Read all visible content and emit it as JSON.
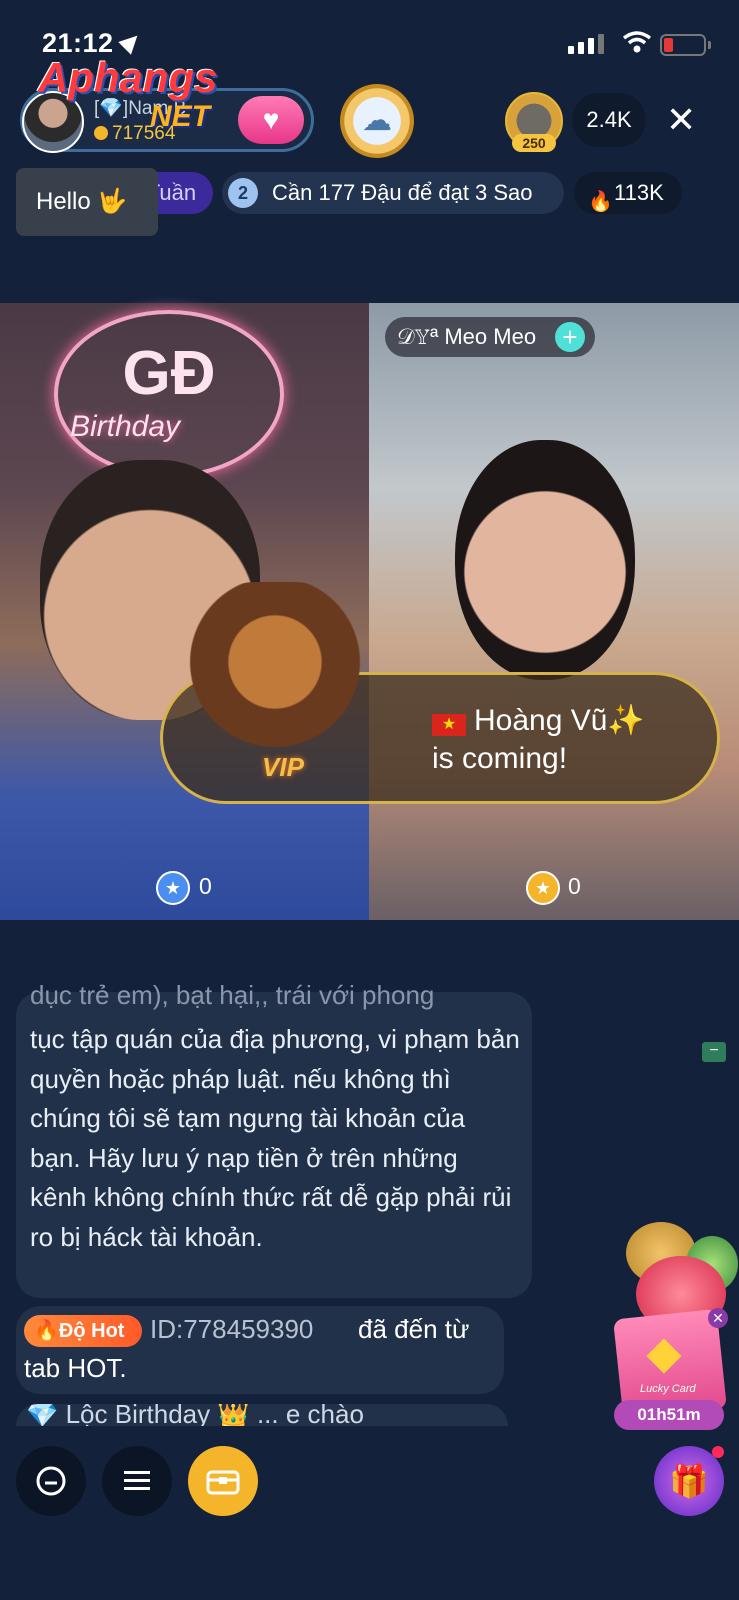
{
  "status": {
    "time": "21:12"
  },
  "host": {
    "name": "[💎]Nam B",
    "coins": "717564"
  },
  "watermark": {
    "line1": "Aphangs",
    "line2": "NET"
  },
  "viewers": {
    "level": "250",
    "count": "2.4K"
  },
  "hello_tip": {
    "label": "Hello 🤟"
  },
  "rank_pill": {
    "label": "TOP 21 Tuần"
  },
  "task": {
    "num": "2",
    "label": "Cần 177 Đậu để đạt 3 Sao"
  },
  "popularity": {
    "value": "113K"
  },
  "guest": {
    "name": "𝒟𝕐ª Meo Meo"
  },
  "stage": {
    "neon_title": "GĐ",
    "neon_sub": "Birthday",
    "vip_label": "VIP"
  },
  "entry_banner": {
    "line1": "Hoàng Vũ✨",
    "line2": "is coming!"
  },
  "scores": {
    "left": "0",
    "right": "0"
  },
  "chat": {
    "partial_line": "dục trẻ em), bạt hại,, trái với phong",
    "notice": "tục tập quán của địa phương, vi phạm bản quyền hoặc pháp luật. nếu không thì chúng tôi sẽ tạm ngưng tài khoản của bạn. Hãy lưu ý nạp tiền ở trên những kênh không chính thức rất dễ gặp phải rủi ro bị háck tài khoản.",
    "hot_badge": "🔥Độ Hot",
    "hot_id": "ID:778459390",
    "hot_msg": "đã đến từ",
    "hot_msg2": "tab HOT.",
    "partial_next": "💎 Lộc Birthday 👑 ... e chào"
  },
  "lucky_card": {
    "label": "Lucky Card",
    "timer": "01h51m"
  },
  "colors": {
    "background": "#13213a",
    "accent": "#f5b52a",
    "chat_bubble": "#22314a"
  }
}
